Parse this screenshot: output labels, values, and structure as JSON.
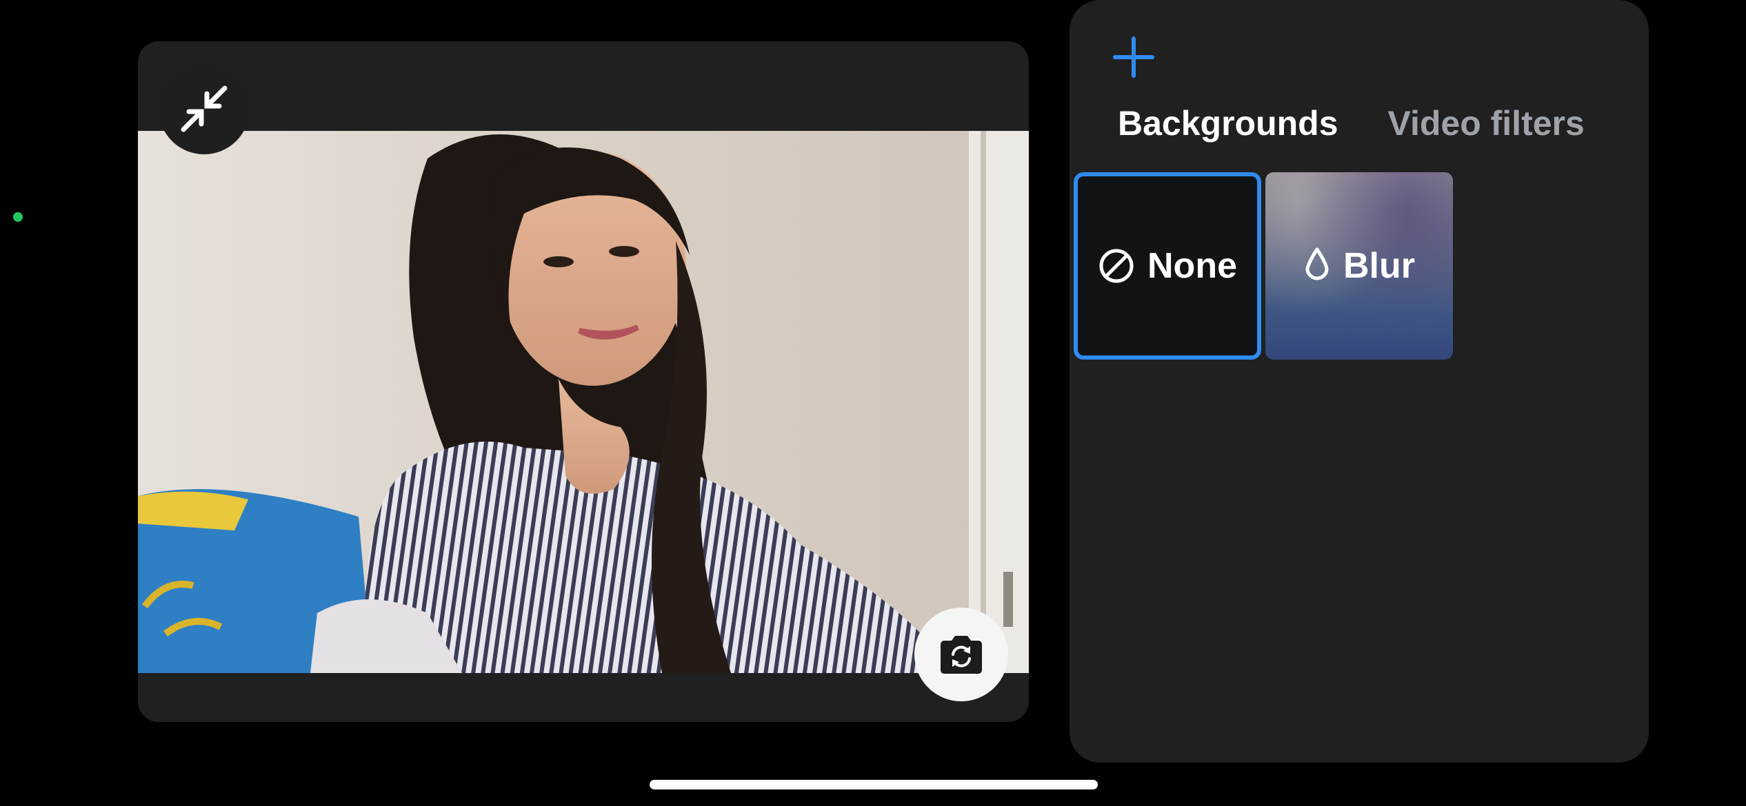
{
  "status": {
    "indicator_color": "#22c55e"
  },
  "preview": {
    "collapse_icon": "collapse-arrows-icon",
    "flip_icon": "camera-flip-icon"
  },
  "panel": {
    "add_icon": "plus-icon",
    "accent_color": "#2f8bf0",
    "tabs": [
      {
        "label": "Backgrounds",
        "active": true
      },
      {
        "label": "Video filters",
        "active": false
      }
    ],
    "options": [
      {
        "label": "None",
        "icon": "no-sign-icon",
        "selected": true
      },
      {
        "label": "Blur",
        "icon": "droplet-icon",
        "selected": false
      }
    ]
  }
}
